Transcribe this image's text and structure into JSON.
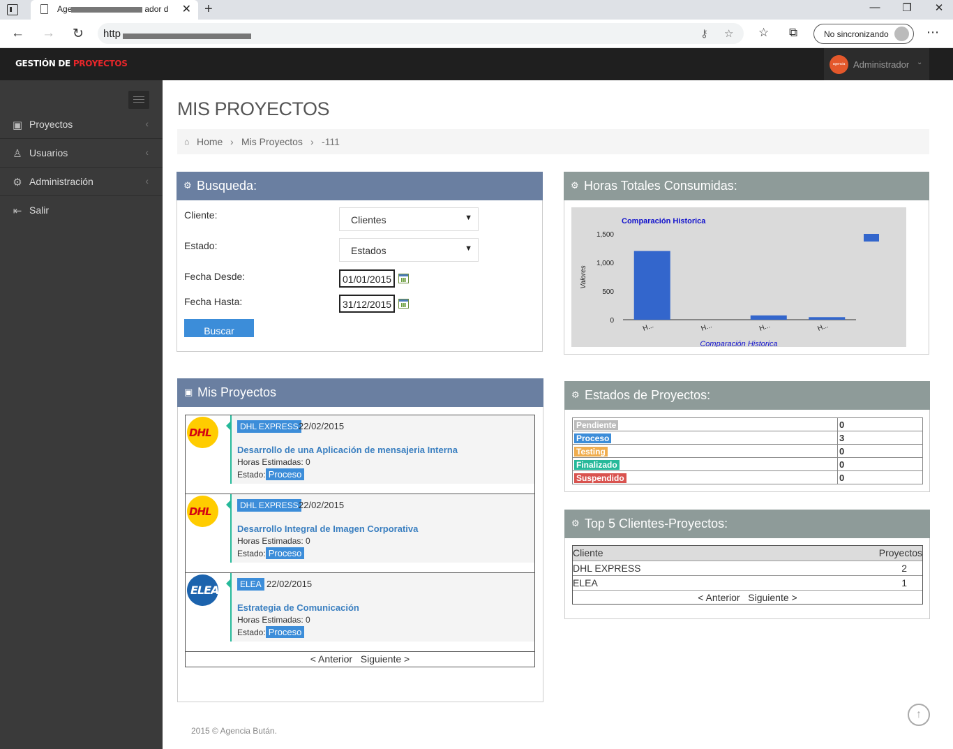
{
  "browser": {
    "tab_title": "Age",
    "tab_title_tail": "ador d",
    "url_prefix": "http",
    "sync_label": "No sincronizando"
  },
  "header": {
    "logo_white": "GESTIÓN DE ",
    "logo_red": "PROYECTOS",
    "user_avatar_text": "agencia bután",
    "user_name": "Administrador"
  },
  "sidebar": {
    "items": [
      {
        "label": "Proyectos",
        "icon": "briefcase-icon",
        "has_arrow": true
      },
      {
        "label": "Usuarios",
        "icon": "user-icon",
        "has_arrow": true
      },
      {
        "label": "Administración",
        "icon": "gear-icon",
        "has_arrow": true
      },
      {
        "label": "Salir",
        "icon": "sign-out-icon",
        "has_arrow": false
      }
    ]
  },
  "page": {
    "title": "MIS PROYECTOS",
    "breadcrumb": [
      "Home",
      "Mis Proyectos",
      "-111"
    ]
  },
  "search": {
    "title": "Busqueda:",
    "cliente_label": "Cliente:",
    "cliente_value": "Clientes",
    "estado_label": "Estado:",
    "estado_value": "Estados",
    "desde_label": "Fecha Desde:",
    "desde_value": "01/01/2015",
    "hasta_label": "Fecha Hasta:",
    "hasta_value": "31/12/2015",
    "button": "Buscar"
  },
  "hours_panel": {
    "title": "Horas Totales Consumidas:"
  },
  "chart_data": {
    "type": "bar",
    "title": "Comparación Historica",
    "xlabel": "Comparación Historica",
    "ylabel": "Valores",
    "categories": [
      "H...",
      "H...",
      "H...",
      "H..."
    ],
    "values": [
      1200,
      0,
      75,
      45
    ],
    "ylim": [
      0,
      1500
    ],
    "yticks": [
      "0",
      "500",
      "1,000",
      "1,500"
    ],
    "series_color": "#3366cc",
    "legend": "right",
    "grid": false
  },
  "projects_panel": {
    "title": "Mis Proyectos",
    "items": [
      {
        "client": "DHL EXPRESS",
        "logo": "DHL",
        "date": "22/02/2015",
        "title": "Desarrollo de una Aplicación de mensajeria Interna",
        "hours_label": "Horas Estimadas:",
        "hours": "0",
        "state_label": "Estado:",
        "state": "Proceso"
      },
      {
        "client": "DHL EXPRESS",
        "logo": "DHL",
        "date": "22/02/2015",
        "title": "Desarrollo Integral de Imagen Corporativa",
        "hours_label": "Horas Estimadas:",
        "hours": "0",
        "state_label": "Estado:",
        "state": "Proceso"
      },
      {
        "client": "ELEA",
        "logo": "ELEA",
        "date": "22/02/2015",
        "title": "Estrategia de Comunicación",
        "hours_label": "Horas Estimadas:",
        "hours": "0",
        "state_label": "Estado:",
        "state": "Proceso"
      }
    ],
    "prev": "< Anterior",
    "next": "Siguiente >"
  },
  "status_panel": {
    "title": "Estados de Proyectos:",
    "rows": [
      {
        "label": "Pendiente",
        "count": "0",
        "color": "#bbbbbb"
      },
      {
        "label": "Proceso",
        "count": "3",
        "color": "#3c8dd9"
      },
      {
        "label": "Testing",
        "count": "0",
        "color": "#f0ad4e"
      },
      {
        "label": "Finalizado",
        "count": "0",
        "color": "#26b99a"
      },
      {
        "label": "Suspendido",
        "count": "0",
        "color": "#d9534f"
      }
    ]
  },
  "top5_panel": {
    "title": "Top 5 Clientes-Proyectos:",
    "col_client": "Cliente",
    "col_projects": "Proyectos",
    "rows": [
      {
        "client": "DHL EXPRESS",
        "projects": "2"
      },
      {
        "client": "ELEA",
        "projects": "1"
      }
    ],
    "prev": "< Anterior",
    "next": "Siguiente >"
  },
  "footer": "2015 © Agencia Bután."
}
